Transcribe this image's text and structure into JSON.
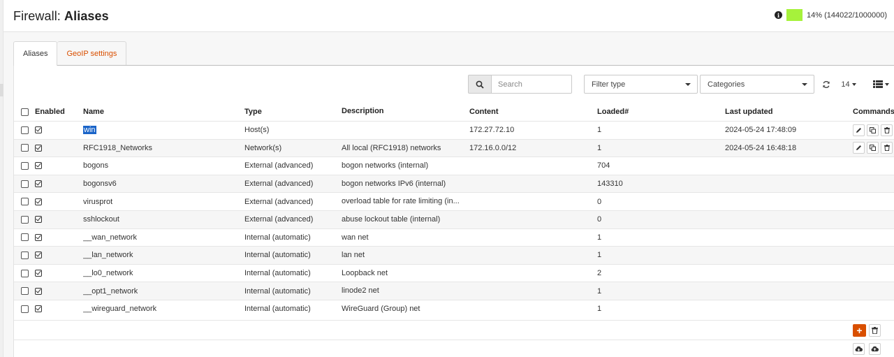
{
  "page": {
    "title_prefix": "Firewall: ",
    "title_main": "Aliases",
    "usage_text": "14% (144022/1000000)",
    "usage_color": "#a6f23b"
  },
  "tabs": [
    {
      "label": "Aliases",
      "active": true
    },
    {
      "label": "GeoIP settings",
      "active": false
    }
  ],
  "toolbar": {
    "search_placeholder": "Search",
    "filter_type": "Filter type",
    "categories": "Categories",
    "page_size": "14",
    "page_size_icon": "caret-down-icon",
    "refresh_icon": "refresh-icon",
    "columns_icon": "list-columns-icon"
  },
  "table": {
    "headers": {
      "enabled": "Enabled",
      "name": "Name",
      "type": "Type",
      "description": "Description",
      "content": "Content",
      "loaded": "Loaded#",
      "last_updated": "Last updated",
      "commands": "Commands"
    },
    "rows": [
      {
        "name": "win",
        "type": "Host(s)",
        "description": "",
        "content": "172.27.72.10",
        "loaded": "1",
        "updated": "2024-05-24 17:48:09",
        "enabled": true,
        "has_commands": true,
        "selected": true
      },
      {
        "name": "RFC1918_Networks",
        "type": "Network(s)",
        "description": "All local (RFC1918) networks",
        "content": "172.16.0.0/12",
        "loaded": "1",
        "updated": "2024-05-24 16:48:18",
        "enabled": true,
        "has_commands": true
      },
      {
        "name": "bogons",
        "type": "External (advanced)",
        "description": "bogon networks (internal)",
        "content": "",
        "loaded": "704",
        "updated": "",
        "enabled": true
      },
      {
        "name": "bogonsv6",
        "type": "External (advanced)",
        "description": "bogon networks IPv6 (internal)",
        "content": "",
        "loaded": "143310",
        "updated": "",
        "enabled": true
      },
      {
        "name": "virusprot",
        "type": "External (advanced)",
        "description": "overload table for rate limiting (in...",
        "content": "",
        "loaded": "0",
        "updated": "",
        "enabled": true
      },
      {
        "name": "sshlockout",
        "type": "External (advanced)",
        "description": "abuse lockout table (internal)",
        "content": "",
        "loaded": "0",
        "updated": "",
        "enabled": true
      },
      {
        "name": "__wan_network",
        "type": "Internal (automatic)",
        "description": "wan net",
        "content": "",
        "loaded": "1",
        "updated": "",
        "enabled": true
      },
      {
        "name": "__lan_network",
        "type": "Internal (automatic)",
        "description": "lan net",
        "content": "",
        "loaded": "1",
        "updated": "",
        "enabled": true
      },
      {
        "name": "__lo0_network",
        "type": "Internal (automatic)",
        "description": "Loopback net",
        "content": "",
        "loaded": "2",
        "updated": "",
        "enabled": true
      },
      {
        "name": "__opt1_network",
        "type": "Internal (automatic)",
        "description": "linode2 net",
        "content": "",
        "loaded": "1",
        "updated": "",
        "enabled": true
      },
      {
        "name": "__wireguard_network",
        "type": "Internal (automatic)",
        "description": "WireGuard (Group) net",
        "content": "",
        "loaded": "1",
        "updated": "",
        "enabled": true
      }
    ]
  },
  "footer": {
    "add_label": "+",
    "accent_color": "#d94f00"
  }
}
